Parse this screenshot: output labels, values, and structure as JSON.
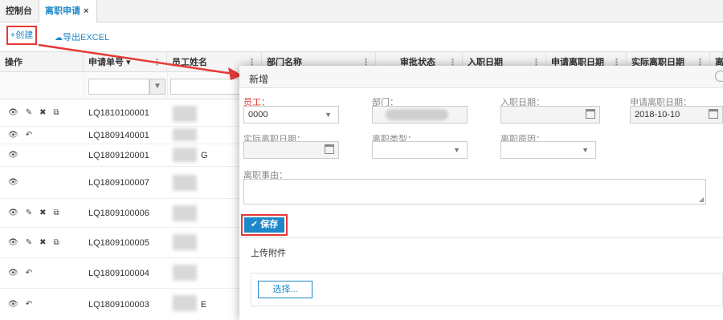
{
  "tabs": {
    "home": "控制台",
    "active": "离职申请",
    "close_glyph": "×"
  },
  "toolbar": {
    "create_label": "+创建",
    "export_label": "导出EXCEL"
  },
  "grid": {
    "columns": [
      "操作",
      "申请单号 ▾",
      "员工姓名",
      "部门名称",
      "审批状态",
      "入职日期",
      "申请离职日期",
      "实际离职日期",
      "离"
    ],
    "rows": [
      {
        "no": "LQ1810100001",
        "ops": "full",
        "tail": ""
      },
      {
        "no": "LQ1809140001",
        "ops": "view-undo",
        "tail": ""
      },
      {
        "no": "LQ1809120001",
        "ops": "view",
        "tail": "G"
      },
      {
        "no": "LQ1809100007",
        "ops": "view",
        "tail": ""
      },
      {
        "no": "LQ1809100006",
        "ops": "full",
        "tail": ""
      },
      {
        "no": "LQ1809100005",
        "ops": "full",
        "tail": ""
      },
      {
        "no": "LQ1809100004",
        "ops": "view-undo",
        "tail": ""
      },
      {
        "no": "LQ1809100003",
        "ops": "view-undo",
        "tail": "E"
      }
    ]
  },
  "modal": {
    "title": "新增",
    "employee_label": "员工：",
    "employee_value": "0000",
    "dept_label": "部门：",
    "hire_date_label": "入职日期：",
    "apply_date_label": "申请离职日期：",
    "apply_date_value": "2018-10-10",
    "actual_date_label": "实际离职日期：",
    "type_label": "离职类型：",
    "reason_label": "离职原因：",
    "cause_label": "离职事由：",
    "save_label": "✔ 保存",
    "attach_label": "上传附件",
    "choose_label": "选择..."
  },
  "colors": {
    "accent": "#1e88c8",
    "highlight": "#e53935"
  }
}
